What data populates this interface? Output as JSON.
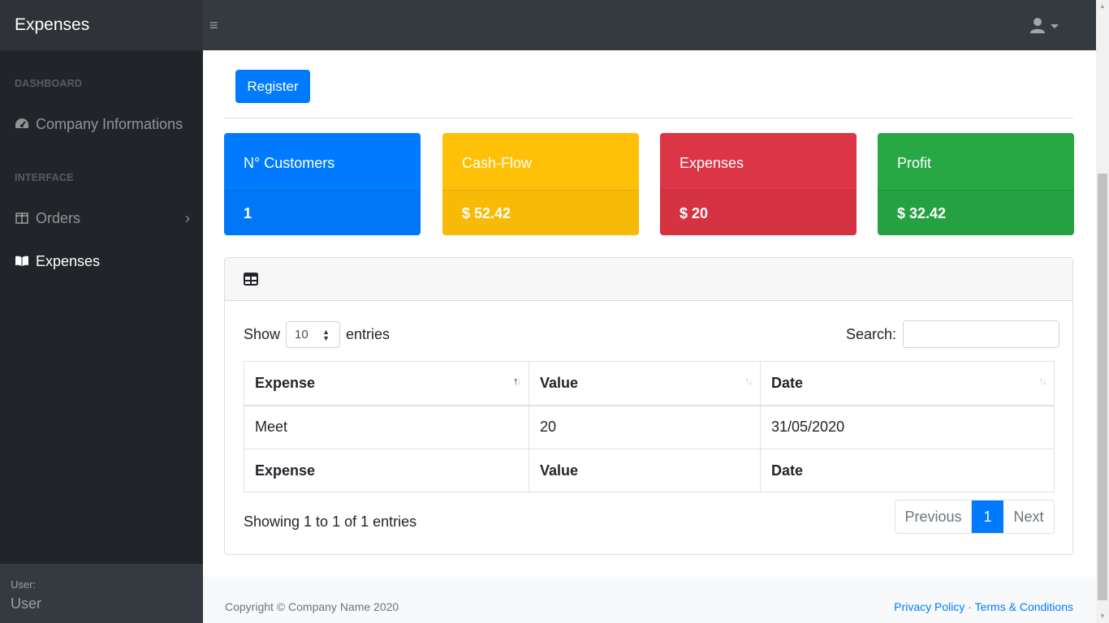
{
  "app": {
    "brand": "Expenses",
    "toggle_glyph": "≡"
  },
  "sidebar": {
    "heading_dashboard": "DASHBOARD",
    "company_label": "Company Informations",
    "heading_interface": "INTERFACE",
    "orders_label": "Orders",
    "orders_chevron": "›",
    "expenses_label": "Expenses",
    "footer_small": "User:",
    "footer_name": "User"
  },
  "main": {
    "register_label": "Register",
    "cards": [
      {
        "title": "N° Customers",
        "value": "1",
        "color": "#007bff"
      },
      {
        "title": "Cash-Flow",
        "value": "$ 52.42",
        "color": "#ffc107"
      },
      {
        "title": "Expenses",
        "value": "$ 20",
        "color": "#dc3545"
      },
      {
        "title": "Profit",
        "value": "$ 32.42",
        "color": "#28a745"
      }
    ],
    "table": {
      "show_label": "Show",
      "entries_value": "10",
      "entries_label": "entries",
      "search_label": "Search:",
      "search_value": "",
      "columns": [
        "Expense",
        "Value",
        "Date"
      ],
      "rows": [
        [
          "Meet",
          "20",
          "31/05/2020"
        ]
      ],
      "footer_columns": [
        "Expense",
        "Value",
        "Date"
      ],
      "info": "Showing 1 to 1 of 1 entries",
      "pagination": {
        "previous": "Previous",
        "current": "1",
        "next": "Next"
      }
    }
  },
  "footer": {
    "copyright": "Copyright © Company Name 2020",
    "privacy": "Privacy Policy",
    "separator": "·",
    "terms": "Terms & Conditions"
  },
  "scrollbar": {
    "up_glyph": "▲",
    "down_glyph": "▼"
  }
}
